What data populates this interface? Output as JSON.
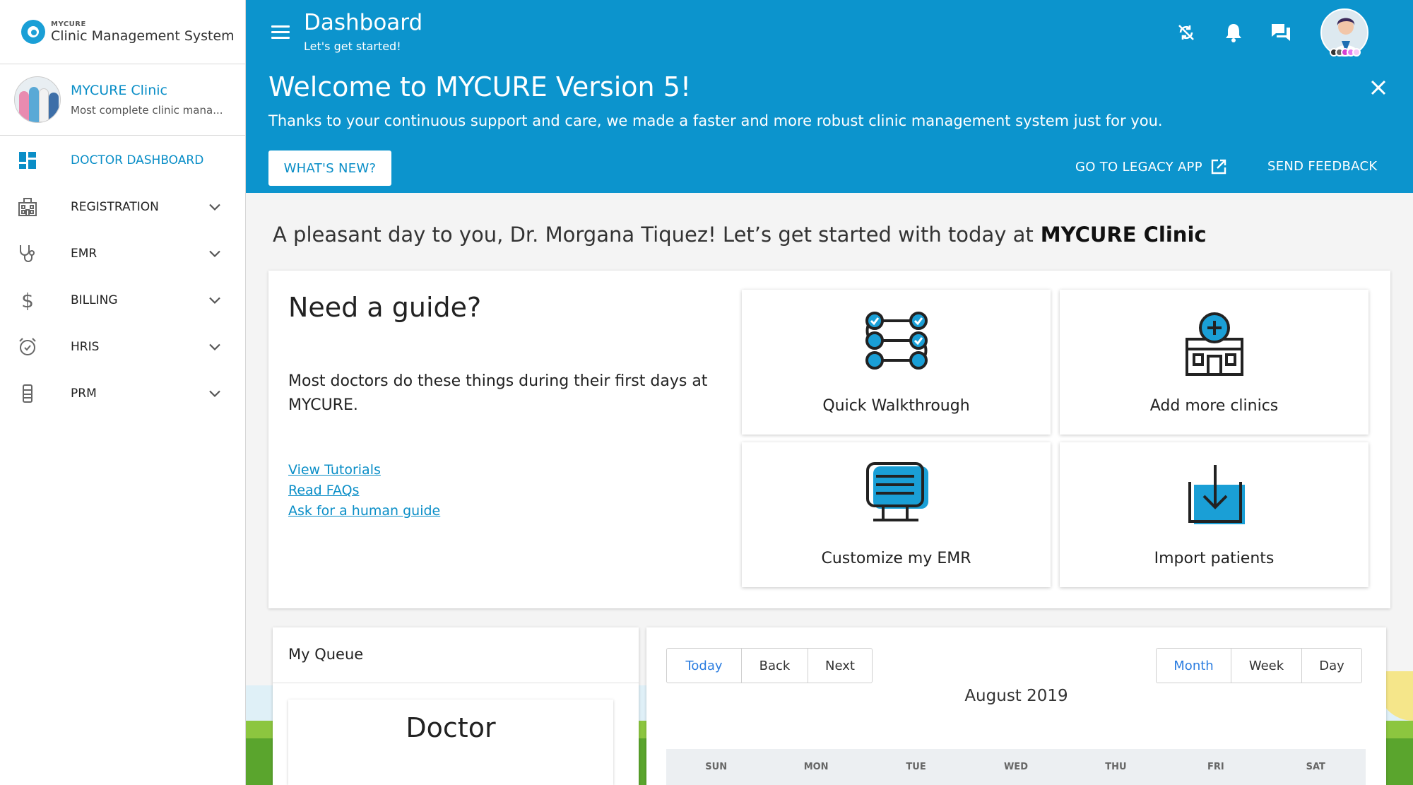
{
  "brand": {
    "small": "MYCURE",
    "name": "Clinic Management System"
  },
  "clinic": {
    "name": "MYCURE Clinic",
    "subtitle": "Most complete clinic mana..."
  },
  "sidebar": {
    "items": [
      {
        "label": "DOCTOR DASHBOARD",
        "icon": "dashboard-icon",
        "active": true
      },
      {
        "label": "REGISTRATION",
        "icon": "building-icon"
      },
      {
        "label": "EMR",
        "icon": "stethoscope-icon"
      },
      {
        "label": "BILLING",
        "icon": "dollar-icon"
      },
      {
        "label": "HRIS",
        "icon": "alarm-clock-icon"
      },
      {
        "label": "PRM",
        "icon": "device-icon"
      }
    ]
  },
  "topbar": {
    "title": "Dashboard",
    "subtitle": "Let's get started!",
    "icons": [
      "sync-off-icon",
      "bell-icon",
      "chat-icon"
    ]
  },
  "banner": {
    "title": "Welcome to MYCURE Version 5!",
    "text": "Thanks to your continuous support and care, we made a faster and more robust clinic management system just for you.",
    "whats_new": "WHAT'S NEW?",
    "legacy": "GO TO LEGACY APP",
    "feedback": "SEND FEEDBACK"
  },
  "greeting": {
    "text": "A pleasant day to you, Dr. Morgana Tiquez! Let’s get started with today at",
    "clinic": "MYCURE Clinic"
  },
  "guide": {
    "title": "Need a guide?",
    "description": "Most doctors do these things during their first days at MYCURE.",
    "links": [
      "View Tutorials",
      "Read FAQs",
      "Ask for a human guide"
    ],
    "tiles": [
      {
        "label": "Quick Walkthrough",
        "icon": "checklist-icon"
      },
      {
        "label": "Add more clinics",
        "icon": "clinic-add-icon"
      },
      {
        "label": "Customize my EMR",
        "icon": "monitor-settings-icon"
      },
      {
        "label": "Import patients",
        "icon": "import-icon"
      }
    ]
  },
  "queue": {
    "title": "My Queue",
    "doctor": "Doctor"
  },
  "calendar": {
    "nav": [
      "Today",
      "Back",
      "Next"
    ],
    "views": [
      "Month",
      "Week",
      "Day"
    ],
    "month": "August 2019",
    "days": [
      "SUN",
      "MON",
      "TUE",
      "WED",
      "THU",
      "FRI",
      "SAT"
    ]
  },
  "colors": {
    "primary": "#0c94cd",
    "accent_link": "#0a8ec7",
    "selected_btn": "#2b7de0"
  }
}
